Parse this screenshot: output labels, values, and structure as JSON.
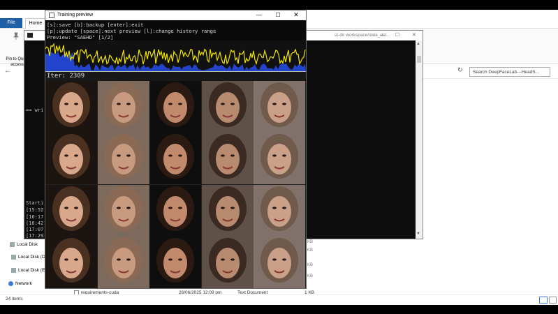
{
  "explorer": {
    "tabs": [
      "File",
      "Home"
    ],
    "ribbon_pin_label": "Pin to Quick access",
    "search_placeholder": "Search DeepFaceLab---HeadS...",
    "nav_items": [
      "Local Disk",
      "Local Disk (D:",
      "Local Disk (E:",
      "Network"
    ],
    "items_count": "24 items",
    "file_row": {
      "name": "requirements-cuda",
      "date": "26/06/2025 12:09 pm",
      "type": "Text Document",
      "size": "1 KB"
    },
    "size_column": [
      "KB",
      "KB",
      "KB",
      "KB"
    ]
  },
  "console": {
    "title_path": "st-dir workspace/data_dst...",
    "left_fragments": [
      "Starti",
      "[15:52",
      "[16:17",
      "[16:42",
      "[17:07",
      "[17:29"
    ],
    "fragment_wri": "== wri",
    "scrollbar_up": "▲",
    "scrollbar_down": "▼"
  },
  "preview": {
    "title": "Training preview",
    "help_line1": "[s]:save [b]:backup [enter]:exit",
    "help_line2": "[p]:update [space]:next preview [l]:change history range",
    "help_line3": "Preview: \"SAEHD\" [1/2]",
    "iter_label": "Iter: 2309",
    "window_controls": {
      "minimize": "—",
      "maximize": "☐",
      "close": "✕"
    },
    "grid_rows": 4,
    "grid_columns": 5,
    "colors": {
      "loss_src": "#f2e600",
      "loss_dst": "#2244cc",
      "background": "#000000"
    }
  }
}
